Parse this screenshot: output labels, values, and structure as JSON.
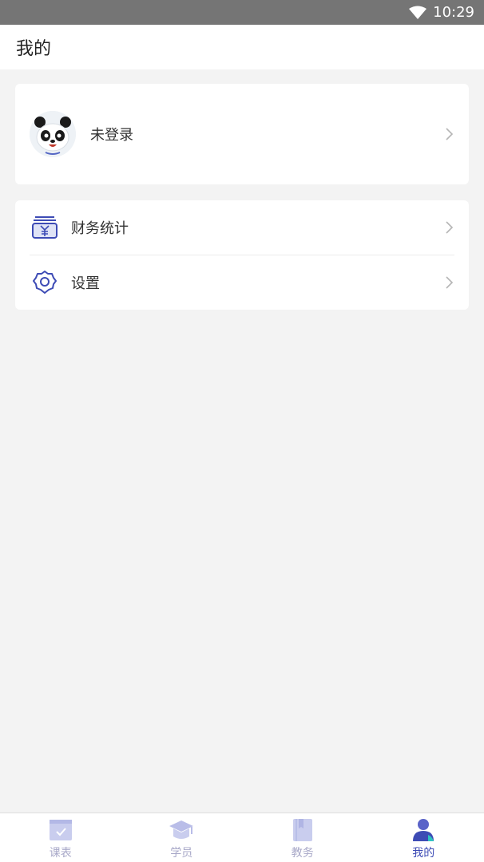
{
  "status_bar": {
    "time": "10:29"
  },
  "header": {
    "title": "我的"
  },
  "profile": {
    "name": "未登录"
  },
  "menu": [
    {
      "label": "财务统计",
      "icon": "finance-icon"
    },
    {
      "label": "设置",
      "icon": "settings-icon"
    }
  ],
  "tabs": [
    {
      "label": "课表",
      "icon": "schedule-icon",
      "active": false
    },
    {
      "label": "学员",
      "icon": "graduation-cap-icon",
      "active": false
    },
    {
      "label": "教务",
      "icon": "book-icon",
      "active": false
    },
    {
      "label": "我的",
      "icon": "user-icon",
      "active": true
    }
  ],
  "colors": {
    "accent": "#3d4bb5",
    "inactive_tab": "#a8a8c8",
    "background": "#f3f3f3"
  }
}
